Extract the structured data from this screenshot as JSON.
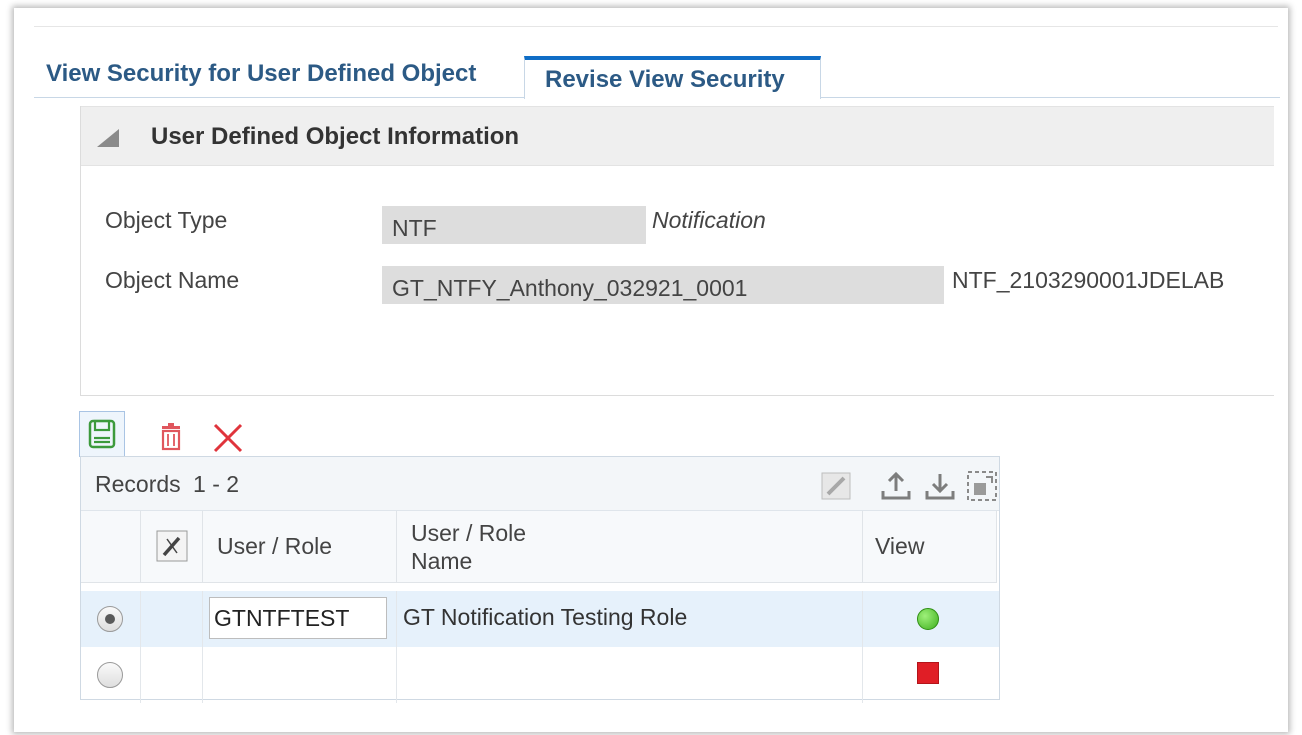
{
  "tabs": [
    {
      "label": "View Security for User Defined Object"
    },
    {
      "label": "Revise View Security",
      "active": true
    }
  ],
  "section": {
    "title": "User Defined Object Information",
    "fields": {
      "object_type": {
        "label": "Object Type",
        "value": "NTF",
        "description": "Notification"
      },
      "object_name": {
        "label": "Object Name",
        "value": "GT_NTFY_Anthony_032921_0001",
        "description": "NTF_2103290001JDELAB"
      }
    }
  },
  "toolbar": {
    "save_icon": "save-icon",
    "delete_icon": "trash-icon",
    "cancel_icon": "close-icon"
  },
  "grid": {
    "records_label": "Records",
    "records_range": "1 - 2",
    "columns": {
      "user_role": "User / Role",
      "user_role_name": "User / Role Name",
      "view": "View"
    },
    "rows": [
      {
        "selected": true,
        "user_role": "GTNTFTEST",
        "user_role_name": "GT Notification Testing Role",
        "view_status": "green-dot"
      },
      {
        "selected": false,
        "user_role": "",
        "user_role_name": "",
        "view_status": "red-square"
      }
    ]
  },
  "colors": {
    "accent": "#0f6dc6",
    "tab_text": "#2c5a85",
    "view_allowed": "#3fb01e",
    "view_denied": "#e01e26"
  }
}
